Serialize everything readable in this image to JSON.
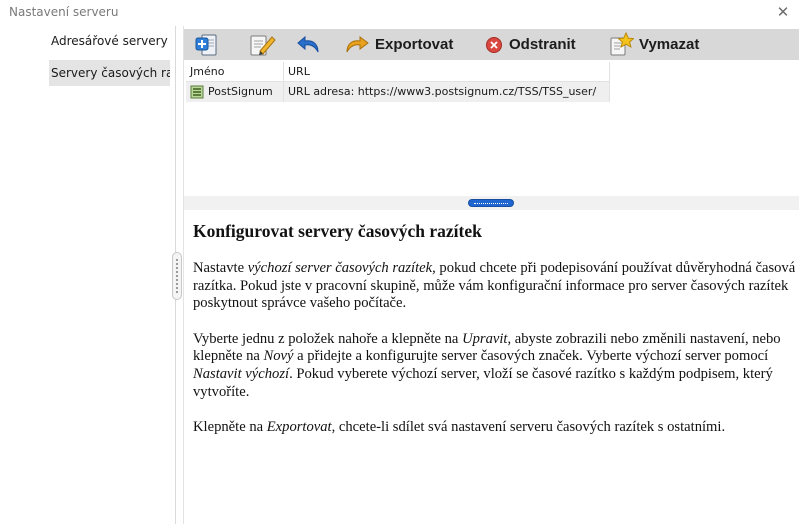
{
  "window": {
    "title": "Nastavení serveru",
    "close_label": "✕"
  },
  "sidebar": {
    "items": [
      {
        "label": "Adresářové servery",
        "selected": false
      },
      {
        "label": "Servery časových razítek",
        "selected": true
      }
    ]
  },
  "toolbar": {
    "new_icon": "add-server-icon",
    "edit_icon": "edit-icon",
    "undo_icon": "undo-icon",
    "export_label": "Exportovat",
    "remove_label": "Odstranit",
    "clear_label": "Vymazat"
  },
  "table": {
    "columns": [
      "Jméno",
      "URL"
    ],
    "rows": [
      {
        "name": "PostSignum",
        "url": "URL adresa: https://www3.postsignum.cz/TSS/TSS_user/",
        "selected": true,
        "icon": "server-icon"
      }
    ]
  },
  "help": {
    "title": "Konfigurovat servery časových razítek",
    "p1": {
      "a": "Nastavte ",
      "b": "výchozí server časových razítek",
      "c": ", pokud chcete při podepisování používat důvěryhodná časová razítka. Pokud jste v pracovní skupině, může vám konfigurační informace pro server časových razítek poskytnout správce vašeho počítače."
    },
    "p2": {
      "a": "Vyberte jednu z položek nahoře a klepněte na ",
      "b": "Upravit",
      "c": ", abyste zobrazili nebo změnili nastavení, nebo klepněte na ",
      "d": "Nový",
      "e": " a přidejte a konfigurujte server časových značek. Vyberte výchozí server pomocí ",
      "f": "Nastavit výchozí",
      "g": ". Pokud vyberete výchozí server, vloží se časové razítko s každým podpisem, který vytvoříte."
    },
    "p3": {
      "a": "Klepněte na ",
      "b": "Exportovat",
      "c": ", chcete-li sdílet svá nastavení serveru časových razítek s ostatními."
    }
  },
  "colors": {
    "toolbar_bg": "#d8d8d8",
    "selected_bg": "#e4e4e4",
    "splitter_handle": "#1f66d1",
    "remove_icon": "#d9473f",
    "export_arrow": "#e8a21c",
    "undo_arrow": "#2a6fc9"
  }
}
